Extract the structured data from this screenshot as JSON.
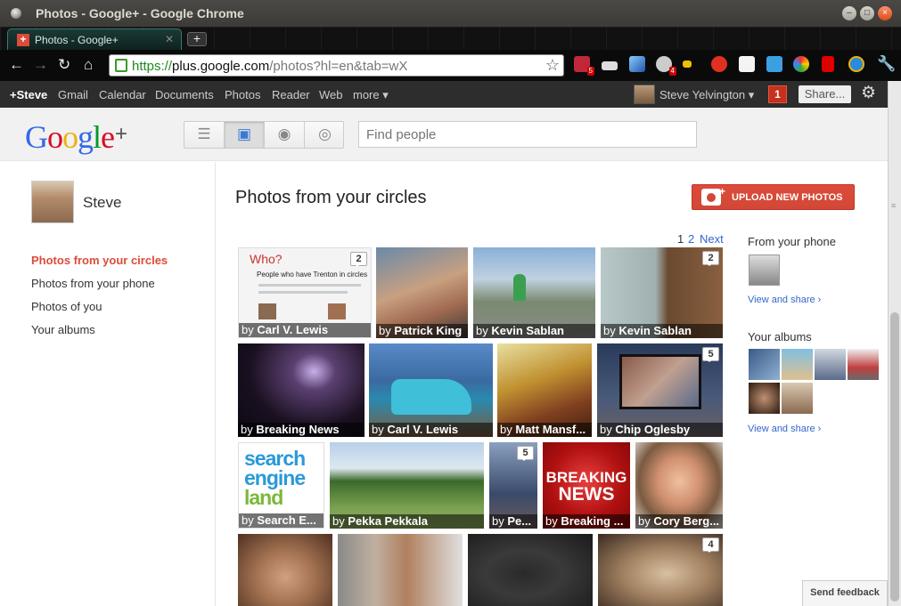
{
  "window": {
    "title": "Photos - Google+ - Google Chrome"
  },
  "browser": {
    "tab_label": "Photos - Google+",
    "url": {
      "scheme": "https://",
      "host": "plus.google.com",
      "path": "/photos?hl=en&tab=wX"
    },
    "ext_badges": [
      "5",
      "4"
    ]
  },
  "gbar": {
    "items": [
      "+Steve",
      "Gmail",
      "Calendar",
      "Documents",
      "Photos",
      "Reader",
      "Web",
      "more ▾"
    ],
    "user_name": "Steve Yelvington ▾",
    "notifications": "1",
    "share_label": "Share..."
  },
  "header": {
    "search_placeholder": "Find people"
  },
  "left": {
    "profile_name": "Steve",
    "nav": [
      "Photos from your circles",
      "Photos from your phone",
      "Photos of you",
      "Your albums"
    ]
  },
  "main": {
    "title": "Photos from your circles",
    "upload_label": "UPLOAD NEW PHOTOS",
    "pager": {
      "page1": "1",
      "page2": "2",
      "next": "Next"
    },
    "tiles": [
      {
        "by": "by",
        "name": "Carl V. Lewis",
        "comments": "2",
        "overlay_title": "Who?",
        "overlay_text": "People who have Trenton in circles"
      },
      {
        "by": "by",
        "name": "Patrick King"
      },
      {
        "by": "by",
        "name": "Kevin Sablan"
      },
      {
        "by": "by",
        "name": "Kevin Sablan",
        "comments": "2"
      },
      {
        "by": "by",
        "name": "Breaking News"
      },
      {
        "by": "by",
        "name": "Carl V. Lewis"
      },
      {
        "by": "by",
        "name": "Matt Mansf..."
      },
      {
        "by": "by",
        "name": "Chip Oglesby",
        "comments": "5"
      },
      {
        "by": "by",
        "name": "Search E...",
        "logo_lines": [
          "search",
          "engine",
          "land"
        ]
      },
      {
        "by": "by",
        "name": "Pekka Pekkala"
      },
      {
        "by": "by",
        "name": "Pe...",
        "comments": "5"
      },
      {
        "by": "by",
        "name": "Breaking ...",
        "logo_lines": [
          "BREAKING",
          "NEWS"
        ]
      },
      {
        "by": "by",
        "name": "Cory Berg..."
      },
      {
        "by": "",
        "name": ""
      },
      {
        "by": "",
        "name": ""
      },
      {
        "by": "",
        "name": ""
      },
      {
        "by": "",
        "name": "",
        "comments": "4"
      }
    ]
  },
  "right": {
    "phone_label": "From your phone",
    "phone_link": "View and share ›",
    "albums_label": "Your albums",
    "albums_link": "View and share ›"
  },
  "footer": {
    "feedback": "Send feedback"
  },
  "colors": {
    "accent_red": "#dd4b39",
    "link_blue": "#3366cc",
    "gbar_bg": "#2d2d2d"
  }
}
